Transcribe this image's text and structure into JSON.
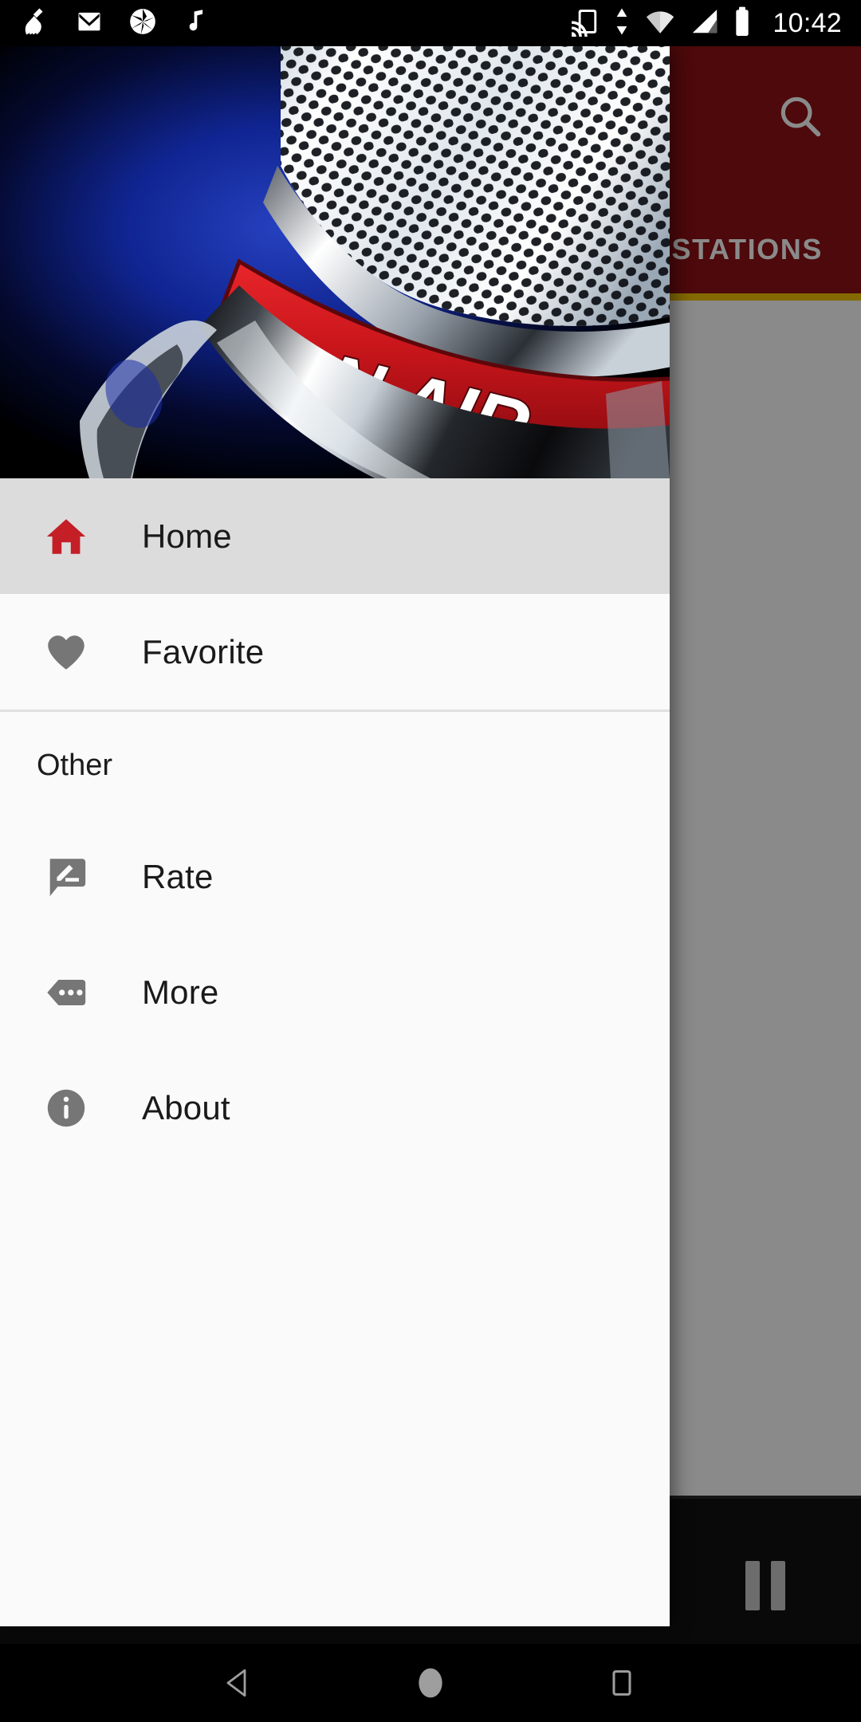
{
  "status_bar": {
    "clock": "10:42",
    "left_icons": [
      {
        "name": "cleaner-broom-icon",
        "glyph": "broom"
      },
      {
        "name": "gmail-icon",
        "glyph": "M"
      },
      {
        "name": "camera-shutter-icon",
        "glyph": "shutter"
      },
      {
        "name": "music-note-icon",
        "glyph": "note"
      }
    ],
    "right_icons": [
      {
        "name": "cast-icon",
        "glyph": "cast"
      },
      {
        "name": "data-transfer-icon",
        "glyph": "up-down-arrows"
      },
      {
        "name": "wifi-icon",
        "glyph": "wifi"
      },
      {
        "name": "cellular-signal-icon",
        "glyph": "signal"
      },
      {
        "name": "battery-icon",
        "glyph": "battery"
      }
    ]
  },
  "app": {
    "toolbar": {
      "background_color": "#8e1216",
      "search_icon_label": "search-icon"
    },
    "tabs": [
      {
        "label": "STATIONS",
        "selected": true
      }
    ],
    "tab_indicator_color": "#f2c200",
    "player": {
      "playpause_label": "pause-button",
      "state": "playing"
    }
  },
  "drawer": {
    "header": {
      "artwork_name": "on-air-microphone-image",
      "artwork_text": "ON AIR"
    },
    "items": [
      {
        "label": "Home",
        "icon": "home-icon",
        "selected": true
      },
      {
        "label": "Favorite",
        "icon": "heart-icon",
        "selected": false
      }
    ],
    "section_other": {
      "title": "Other",
      "items": [
        {
          "label": "Rate",
          "icon": "rate-review-icon"
        },
        {
          "label": "More",
          "icon": "more-label-icon"
        },
        {
          "label": "About",
          "icon": "info-icon"
        }
      ]
    },
    "colors": {
      "background": "#fafafa",
      "selected_background": "#dcdcdc",
      "accent_red": "#c41e27",
      "icon_gray": "#757575"
    }
  },
  "nav_bar": {
    "buttons": [
      {
        "name": "back-button",
        "glyph": "triangle-left"
      },
      {
        "name": "home-button",
        "glyph": "circle"
      },
      {
        "name": "recents-button",
        "glyph": "square"
      }
    ]
  }
}
